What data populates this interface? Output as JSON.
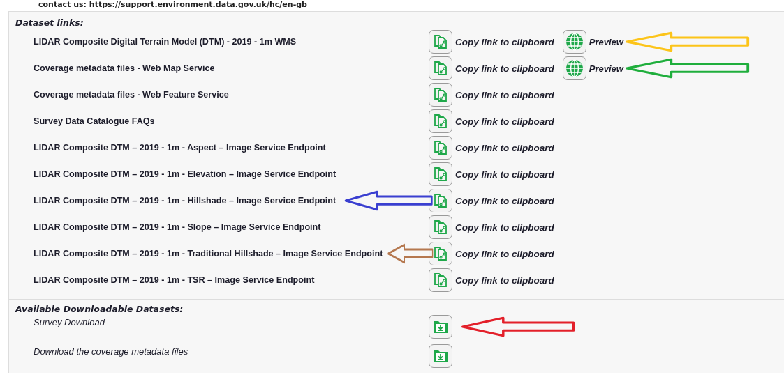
{
  "contact_line": "contact us: https://support.environment.data.gov.uk/hc/en-gb",
  "dataset_links": {
    "heading": "Dataset links:",
    "rows": [
      {
        "label": "LIDAR Composite Digital Terrain Model (DTM) - 2019 - 1m WMS",
        "actions": [
          {
            "kind": "copy",
            "label": "Copy link to clipboard"
          },
          {
            "kind": "preview",
            "label": "Preview"
          }
        ],
        "arrow": {
          "color": "#fcc419",
          "kind": "trailing"
        }
      },
      {
        "label": "Coverage metadata files - Web Map Service",
        "actions": [
          {
            "kind": "copy",
            "label": "Copy link to clipboard"
          },
          {
            "kind": "preview",
            "label": "Preview"
          }
        ],
        "arrow": {
          "color": "#1fae3c",
          "kind": "trailing"
        }
      },
      {
        "label": "Coverage metadata files - Web Feature Service",
        "actions": [
          {
            "kind": "copy",
            "label": "Copy link to clipboard"
          }
        ]
      },
      {
        "label": "Survey Data Catalogue FAQs",
        "actions": [
          {
            "kind": "copy",
            "label": "Copy link to clipboard"
          }
        ]
      },
      {
        "label": "LIDAR Composite DTM – 2019 - 1m - Aspect – Image Service Endpoint",
        "actions": [
          {
            "kind": "copy",
            "label": "Copy link to clipboard"
          }
        ]
      },
      {
        "label": "LIDAR Composite DTM – 2019 - 1m - Elevation – Image Service Endpoint",
        "actions": [
          {
            "kind": "copy",
            "label": "Copy link to clipboard"
          }
        ]
      },
      {
        "label": "LIDAR Composite DTM – 2019 - 1m - Hillshade – Image Service Endpoint",
        "actions": [
          {
            "kind": "copy",
            "label": "Copy link to clipboard"
          }
        ],
        "arrow": {
          "color": "#3a3fd0",
          "kind": "overlay"
        }
      },
      {
        "label": "LIDAR Composite DTM – 2019 - 1m - Slope – Image Service Endpoint",
        "actions": [
          {
            "kind": "copy",
            "label": "Copy link to clipboard"
          }
        ]
      },
      {
        "label": "LIDAR Composite DTM – 2019 - 1m - Traditional Hillshade – Image Service Endpoint",
        "actions": [
          {
            "kind": "copy",
            "label": "Copy link to clipboard"
          }
        ],
        "arrow": {
          "color": "#b5784f",
          "kind": "overlay-short"
        }
      },
      {
        "label": "LIDAR Composite DTM – 2019 - 1m - TSR – Image Service Endpoint",
        "actions": [
          {
            "kind": "copy",
            "label": "Copy link to clipboard"
          }
        ]
      }
    ]
  },
  "downloads": {
    "heading": "Available Downloadable Datasets:",
    "rows": [
      {
        "label": "Survey Download",
        "arrow": {
          "color": "#e3202a",
          "kind": "trailing"
        }
      },
      {
        "label": "Download the coverage metadata files"
      }
    ]
  }
}
